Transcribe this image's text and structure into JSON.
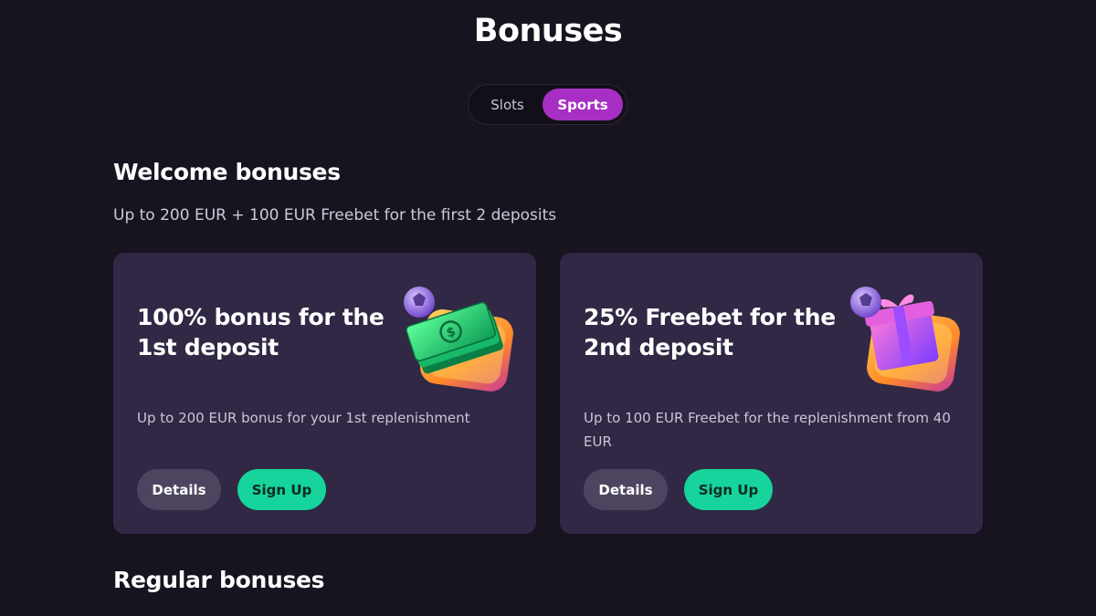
{
  "page": {
    "title": "Bonuses"
  },
  "tabs": {
    "items": [
      {
        "label": "Slots",
        "active": false
      },
      {
        "label": "Sports",
        "active": true
      }
    ],
    "active_color": "#a72fc4"
  },
  "welcome": {
    "title": "Welcome bonuses",
    "subtitle": "Up to 200 EUR + 100 EUR Freebet for the first 2 deposits",
    "cards": [
      {
        "title": "100% bonus for the 1st deposit",
        "description": "Up to 200 EUR bonus for your 1st replenishment",
        "details_label": "Details",
        "signup_label": "Sign Up",
        "icon": "money-stack-icon"
      },
      {
        "title": "25% Freebet for the 2nd deposit",
        "description": "Up to 100 EUR Freebet for the replenishment from 40 EUR",
        "details_label": "Details",
        "signup_label": "Sign Up",
        "icon": "gift-box-icon"
      }
    ]
  },
  "regular": {
    "title": "Regular bonuses"
  },
  "colors": {
    "background": "#17131f",
    "card": "#302845",
    "signup_button": "#16d49b",
    "details_button": "#4d4560"
  }
}
